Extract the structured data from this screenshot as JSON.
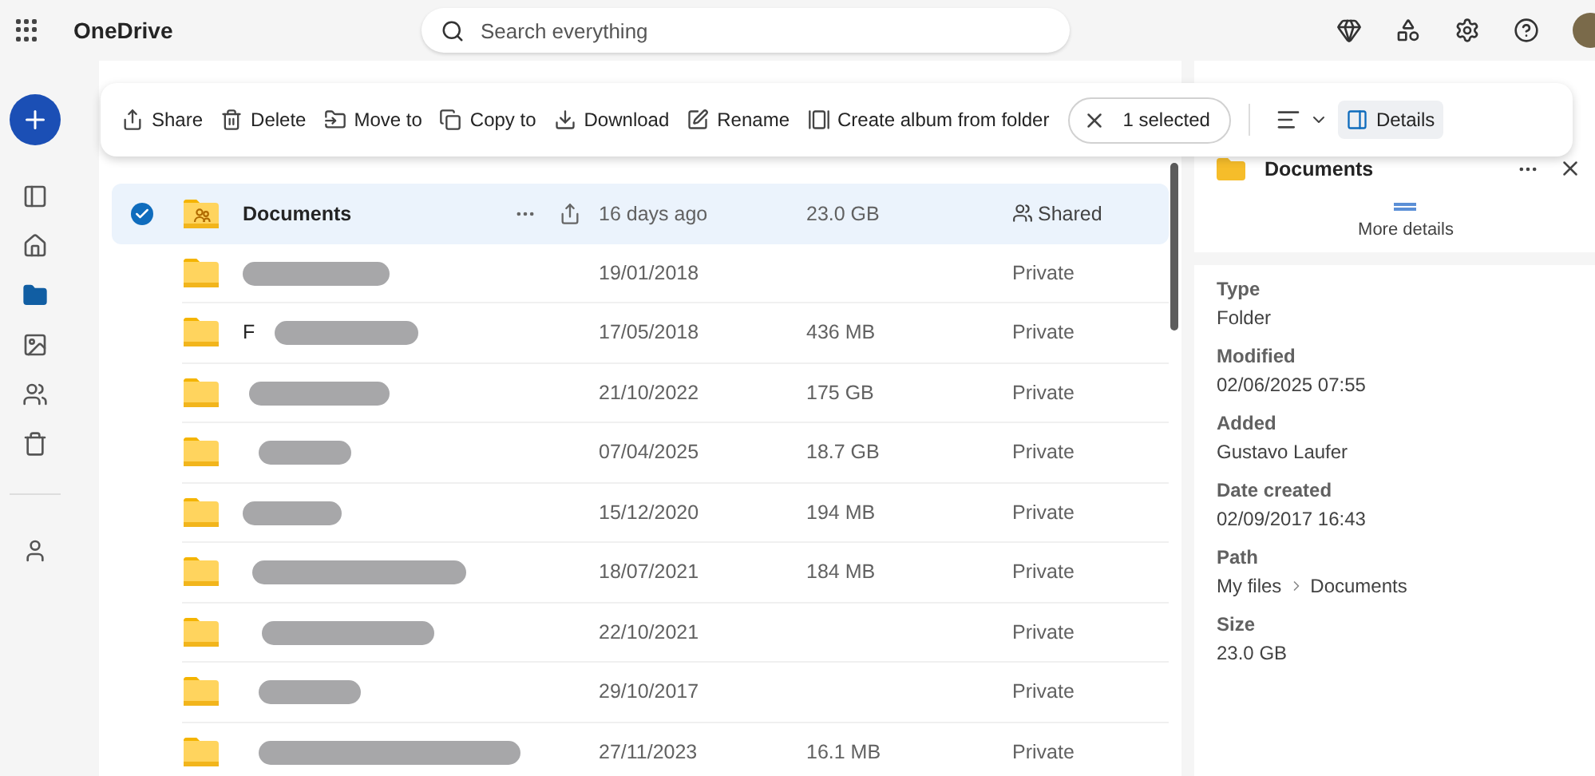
{
  "app": {
    "title": "OneDrive"
  },
  "search": {
    "placeholder": "Search everything"
  },
  "toolbar": {
    "actions": [
      {
        "kind": "share",
        "label": "Share"
      },
      {
        "kind": "delete",
        "label": "Delete"
      },
      {
        "kind": "move",
        "label": "Move to"
      },
      {
        "kind": "copy",
        "label": "Copy to"
      },
      {
        "kind": "download",
        "label": "Download"
      },
      {
        "kind": "rename",
        "label": "Rename"
      },
      {
        "kind": "album",
        "label": "Create album from folder"
      }
    ],
    "selection": "1 selected",
    "details": {
      "label": "Details",
      "selected": true
    }
  },
  "sidebar": {
    "items": [
      {
        "kind": "pane",
        "selected": false
      },
      {
        "kind": "home",
        "selected": false
      },
      {
        "kind": "files",
        "selected": true
      },
      {
        "kind": "photos",
        "selected": false
      },
      {
        "kind": "shared",
        "selected": false
      },
      {
        "kind": "recycle",
        "selected": false
      },
      {
        "kind": "people",
        "selected": false
      }
    ]
  },
  "files": [
    {
      "name": "Documents",
      "redacted": false,
      "date": "16 days ago",
      "size": "23.0 GB",
      "sharing": "Shared",
      "shared": true,
      "selected": true
    },
    {
      "redacted": true,
      "date": "19/01/2018",
      "sharing": "Private",
      "shared": false,
      "selected": false
    },
    {
      "name": "F",
      "redacted": true,
      "date": "17/05/2018",
      "size": "436 MB",
      "sharing": "Private",
      "shared": false,
      "selected": false
    },
    {
      "redacted": true,
      "date": "21/10/2022",
      "size": "175 GB",
      "sharing": "Private",
      "shared": false,
      "selected": false
    },
    {
      "redacted": true,
      "date": "07/04/2025",
      "size": "18.7 GB",
      "sharing": "Private",
      "shared": false,
      "selected": false
    },
    {
      "redacted": true,
      "date": "15/12/2020",
      "size": "194 MB",
      "sharing": "Private",
      "shared": false,
      "selected": false
    },
    {
      "redacted": true,
      "date": "18/07/2021",
      "size": "184 MB",
      "sharing": "Private",
      "shared": false,
      "selected": false
    },
    {
      "redacted": true,
      "date": "22/10/2021",
      "sharing": "Private",
      "shared": false,
      "selected": false
    },
    {
      "redacted": true,
      "date": "29/10/2017",
      "sharing": "Private",
      "shared": false,
      "selected": false
    },
    {
      "redacted": true,
      "date": "27/11/2023",
      "size": "16.1 MB",
      "sharing": "Private",
      "shared": false,
      "selected": false
    }
  ],
  "details_pane": {
    "title": "Documents",
    "more": "More details",
    "properties": [
      {
        "label": "Type",
        "value": "Folder"
      },
      {
        "label": "Modified",
        "value": "02/06/2025 07:55"
      },
      {
        "label": "Added",
        "value": "Gustavo Laufer"
      },
      {
        "label": "Date created",
        "value": "02/09/2017 16:43"
      },
      {
        "label": "Path",
        "path": [
          "My files",
          "Documents"
        ]
      },
      {
        "label": "Size",
        "value": "23.0 GB"
      }
    ]
  }
}
